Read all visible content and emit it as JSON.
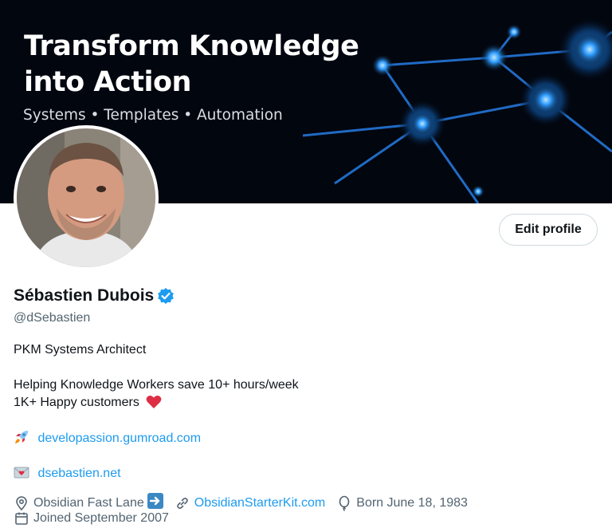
{
  "banner": {
    "title_line1": "Transform Knowledge",
    "title_line2": "into Action",
    "subtitle": "Systems • Templates • Automation"
  },
  "profile": {
    "edit_button": "Edit profile",
    "name": "Sébastien Dubois",
    "verified": true,
    "handle": "@dSebastien"
  },
  "bio": {
    "line1": "PKM Systems Architect",
    "line2": "Helping Knowledge Workers save 10+ hours/week",
    "line3": "1K+ Happy customers",
    "link1": "developassion.gumroad.com",
    "link2": "dsebastien.net"
  },
  "meta": {
    "location": "Obsidian Fast Lane",
    "website": "ObsidianStarterKit.com",
    "birthday": "Born June 18, 1983",
    "joined": "Joined September 2007"
  },
  "colors": {
    "accent": "#1d9bf0",
    "text": "#0f1419",
    "muted": "#536471",
    "banner_bg": "#02060f",
    "glow": "#3aa8ff"
  },
  "icons": [
    "verified-badge-icon",
    "rocket-icon",
    "heart-icon",
    "envelope-heart-icon",
    "location-pin-icon",
    "arrow-right-icon",
    "link-icon",
    "balloon-icon",
    "calendar-icon"
  ]
}
